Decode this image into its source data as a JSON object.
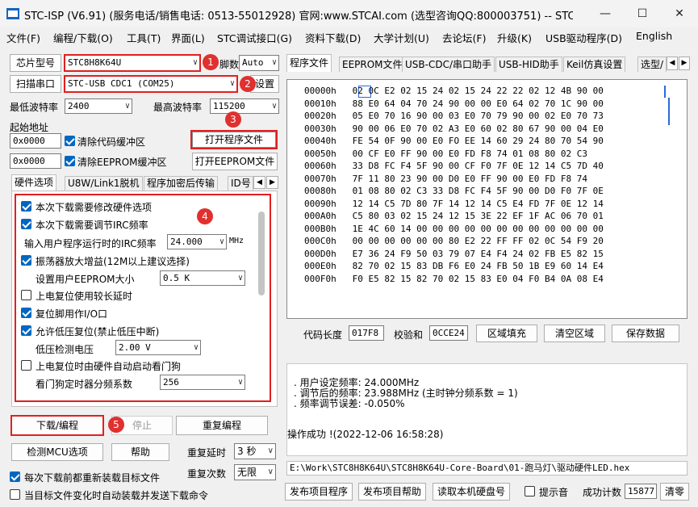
{
  "window": {
    "title": "STC-ISP (V6.91) (服务电话/销售电话: 0513-55012928) 官网:www.STCAI.com  (选型咨询QQ:800003751) -- STC: 全球最...",
    "minimize": "—",
    "maximize": "☐",
    "close": "✕"
  },
  "menu": [
    "文件(F)",
    "编程/下载(O)",
    "工具(T)",
    "界面(L)",
    "STC调试接口(G)",
    "资料下载(D)",
    "大学计划(U)",
    "去论坛(F)",
    "升级(K)",
    "USB驱动程序(D)",
    "English"
  ],
  "left": {
    "chip_type_label": "芯片型号",
    "chip_type_value": "STC8H8K64U",
    "pin_count_label": "脚数",
    "pin_count_value": "Auto",
    "scan_port_label": "扫描串口",
    "port_value": "STC-USB CDC1 (COM25)",
    "settings_label": "设置",
    "min_baud_label": "最低波特率",
    "min_baud_value": "2400",
    "max_baud_label": "最高波特率",
    "max_baud_value": "115200",
    "start_addr_label": "起始地址",
    "start_addr_code": "0x0000",
    "clear_code_label": "清除代码缓冲区",
    "open_program_label": "打开程序文件",
    "start_addr_eeprom": "0x0000",
    "clear_eeprom_label": "清除EEPROM缓冲区",
    "open_eeprom_label": "打开EEPROM文件",
    "tabs": [
      "硬件选项",
      "U8W/Link1脱机",
      "程序加密后传输",
      "ID号"
    ],
    "options": {
      "modify_hw": "本次下载需要修改硬件选项",
      "adjust_irc": "本次下载需要调节IRC频率",
      "irc_input_label": "输入用户程序运行时的IRC频率",
      "irc_value": "24.000",
      "irc_unit": "MHz",
      "osc_gain": "振荡器放大增益(12M以上建议选择)",
      "eeprom_size_label": "设置用户EEPROM大小",
      "eeprom_size_value": "0.5 K",
      "long_reset": "上电复位使用较长延时",
      "reset_pin_io": "复位脚用作I/O口",
      "low_volt_reset": "允许低压复位(禁止低压中断)",
      "low_volt_label": "低压检测电压",
      "low_volt_value": "2.00 V",
      "watchdog_auto": "上电复位时由硬件自动启动看门狗",
      "watchdog_div_label": "看门狗定时器分频系数",
      "watchdog_div_value": "256"
    },
    "download_label": "下载/编程",
    "stop_label": "停止",
    "reprogram_label": "重复编程",
    "detect_mcu_label": "检测MCU选项",
    "help_label": "帮助",
    "repeat_delay_label": "重复延时",
    "repeat_delay_value": "3 秒",
    "repeat_count_label": "重复次数",
    "repeat_count_value": "无限",
    "reload_each_label": "每次下载前都重新装载目标文件",
    "auto_reload_label": "当目标文件变化时自动装载并发送下载命令"
  },
  "badges": [
    "1",
    "2",
    "3",
    "4",
    "5"
  ],
  "right": {
    "tabs": [
      "程序文件",
      "EEPROM文件",
      "USB-CDC/串口助手",
      "USB-HID助手",
      "Keil仿真设置",
      "选型/"
    ],
    "hex_rows": [
      {
        "addr": "00000h",
        "bytes": "02 0C E2 02 15 24 02 15 24 22 22 02 12 4B 90 00"
      },
      {
        "addr": "00010h",
        "bytes": "88 E0 64 04 70 24 90 00 00 E0 64 02 70 1C 90 00"
      },
      {
        "addr": "00020h",
        "bytes": "05 E0 70 16 90 00 03 E0 70 79 90 00 02 E0 70 73"
      },
      {
        "addr": "00030h",
        "bytes": "90 00 06 E0 70 02 A3 E0 60 02 80 67 90 00 04 E0"
      },
      {
        "addr": "00040h",
        "bytes": "FE 54 0F 90 00 E0 FO EE 14 60 29 24 80 70 54 90"
      },
      {
        "addr": "00050h",
        "bytes": "00 CF E0 FF 90 00 E0 FD F8 74 01 08 80 02 C3"
      },
      {
        "addr": "00060h",
        "bytes": "33 D8 FC F4 5F 90 00 CF F0 7F 0E 12 14 C5 7D 40"
      },
      {
        "addr": "00070h",
        "bytes": "7F 11 80 23 90 00 D0 E0 FF 90 00 E0 FD F8 74"
      },
      {
        "addr": "00080h",
        "bytes": "01 08 80 02 C3 33 D8 FC F4 5F 90 00 D0 F0 7F 0E"
      },
      {
        "addr": "00090h",
        "bytes": "12 14 C5 7D 80 7F 14 12 14 C5 E4 FD 7F 0E 12 14"
      },
      {
        "addr": "000A0h",
        "bytes": "C5 80 03 02 15 24 12 15 3E 22 EF 1F AC 06 70 01"
      },
      {
        "addr": "000B0h",
        "bytes": "1E 4C 60 14 00 00 00 00 00 00 00 00 00 00 00 00"
      },
      {
        "addr": "000C0h",
        "bytes": "00 00 00 00 00 00 80 E2 22 FF FF 02 0C 54 F9 20"
      },
      {
        "addr": "000D0h",
        "bytes": "E7 36 24 F9 50 03 79 07 E4 F4 24 02 FB E5 82 15"
      },
      {
        "addr": "000E0h",
        "bytes": "82 70 02 15 83 DB F6 E0 24 FB 50 1B E9 60 14 E4"
      },
      {
        "addr": "000F0h",
        "bytes": "F0 E5 82 15 82 70 02 15 83 E0 04 F0 B4 0A 08 E4"
      }
    ],
    "code_length_label": "代码长度",
    "code_length_value": "017F8",
    "checksum_label": "校验和",
    "checksum_value": "0CCE24",
    "fill_area_label": "区域填充",
    "clear_area_label": "清空区域",
    "save_data_label": "保存数据",
    "log_lines": [
      ". 用户设定频率: 24.000MHz",
      ". 调节后的频率: 23.988MHz (主时钟分频系数 = 1)",
      ". 频率调节误差: -0.050%"
    ],
    "log_success": "操作成功 !(2022-12-06 16:58:28)",
    "file_path": "E:\\Work\\STC8H8K64U\\STC8H8K64U-Core-Board\\01-跑马灯\\驱动硬件LED.hex",
    "publish_program_label": "发布项目程序",
    "publish_help_label": "发布项目帮助",
    "read_disk_label": "读取本机硬盘号",
    "beep_label": "提示音",
    "success_count_label": "成功计数",
    "success_count_value": "15877",
    "clear_label": "清零"
  },
  "colors": {
    "accent": "#0067c0",
    "highlight": "#e02020"
  }
}
